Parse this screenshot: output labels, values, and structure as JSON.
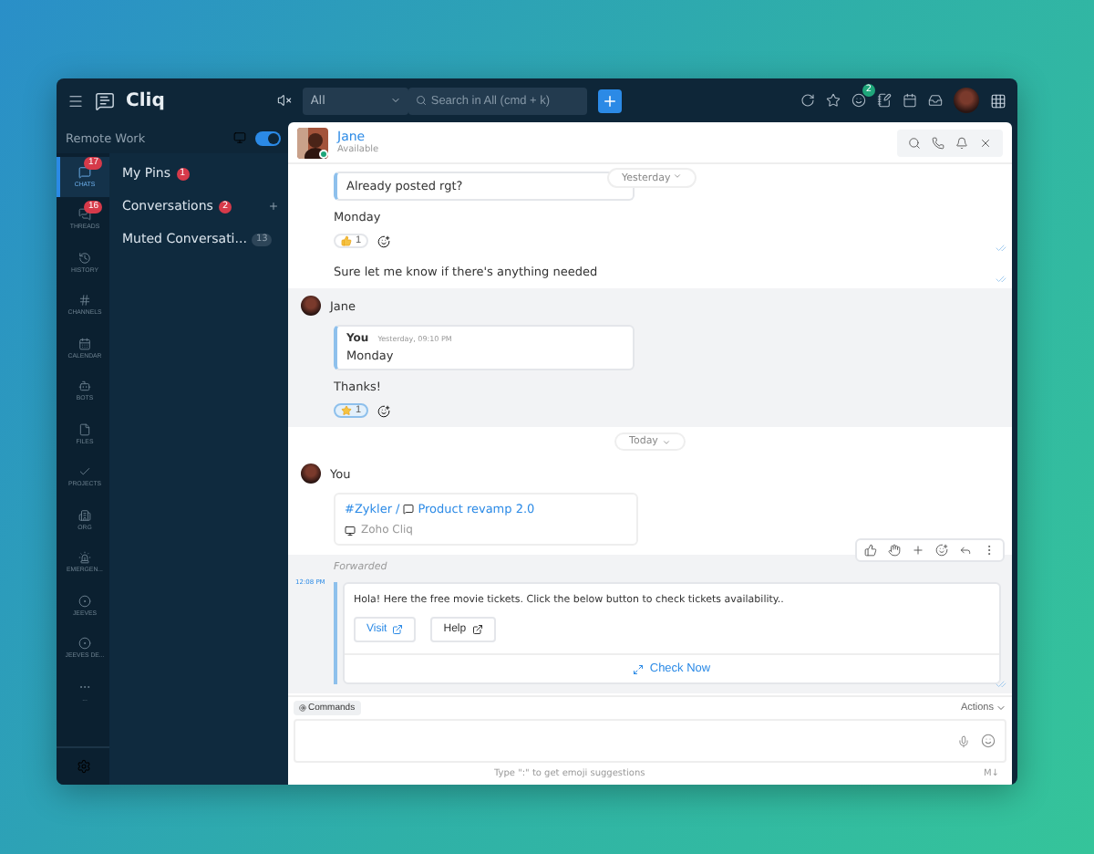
{
  "app": {
    "name": "Cliq"
  },
  "search": {
    "scope": "All",
    "placeholder": "Search in All (cmd + k)"
  },
  "top_icons": [
    {
      "kind": "refresh"
    },
    {
      "kind": "star"
    },
    {
      "kind": "status",
      "badge": "2"
    },
    {
      "kind": "note"
    },
    {
      "kind": "calendar"
    },
    {
      "kind": "inbox"
    }
  ],
  "workspace": {
    "name": "Remote Work",
    "toggle_on": true
  },
  "rail": [
    {
      "label": "CHATS",
      "kind": "chat",
      "badge": "17",
      "selected": true
    },
    {
      "label": "THREADS",
      "kind": "thread",
      "badge": "16",
      "selected": false
    },
    {
      "label": "HISTORY",
      "kind": "history",
      "selected": false
    },
    {
      "label": "CHANNELS",
      "kind": "hash",
      "selected": false
    },
    {
      "label": "CALENDAR",
      "kind": "calendar",
      "selected": false
    },
    {
      "label": "BOTS",
      "kind": "bot",
      "selected": false
    },
    {
      "label": "FILES",
      "kind": "file",
      "selected": false
    },
    {
      "label": "PROJECTS",
      "kind": "check",
      "selected": false
    },
    {
      "label": "ORG",
      "kind": "org",
      "selected": false
    },
    {
      "label": "EMERGEN...",
      "kind": "alert",
      "selected": false
    },
    {
      "label": "JEEVES",
      "kind": "jeeves",
      "selected": false
    },
    {
      "label": "JEEVES DE...",
      "kind": "jeeves",
      "selected": false
    },
    {
      "label": "...",
      "kind": "more",
      "selected": false
    }
  ],
  "sidebar": [
    {
      "label": "My Pins",
      "badge": "1",
      "kind": "alert"
    },
    {
      "label": "Conversations",
      "badge": "2",
      "kind": "alert",
      "add": true
    },
    {
      "label": "Muted Conversati...",
      "badge": "13",
      "kind": "muted"
    }
  ],
  "chat": {
    "name": "Jane",
    "status": "Available",
    "online": true
  },
  "messages": [
    {
      "kind": "plain",
      "quote": "Already posted rgt?",
      "date": "Yesterday",
      "text": "Monday",
      "reaction": {
        "kind": "thumb",
        "count": "1",
        "selected": false
      }
    },
    {
      "kind": "plain",
      "text": "Sure let me know if there's anything needed"
    },
    {
      "kind": "reply",
      "author": "Jane",
      "quote_author": "You",
      "quote_time": "Yesterday, 09:10 PM",
      "quote": "Monday",
      "text": "Thanks!",
      "reaction": {
        "kind": "star",
        "count": "1",
        "selected": true
      }
    },
    {
      "kind": "divider",
      "date": "Today"
    },
    {
      "kind": "link",
      "author": "You",
      "channel": "#Zykler",
      "separator": "/",
      "title": "Product revamp 2.0",
      "source": "Zoho Cliq"
    },
    {
      "kind": "card",
      "label": "Forwarded",
      "time": "12:08 PM",
      "text": "Hola! Here the free movie tickets. Click the below button to check tickets availability..",
      "buttons": [
        "Visit",
        "Help"
      ],
      "action": "Check Now"
    }
  ],
  "composer": {
    "commands": "Commands",
    "actions": "Actions",
    "hint": "Type \":\" to get emoji suggestions",
    "markdown": "M↓"
  }
}
